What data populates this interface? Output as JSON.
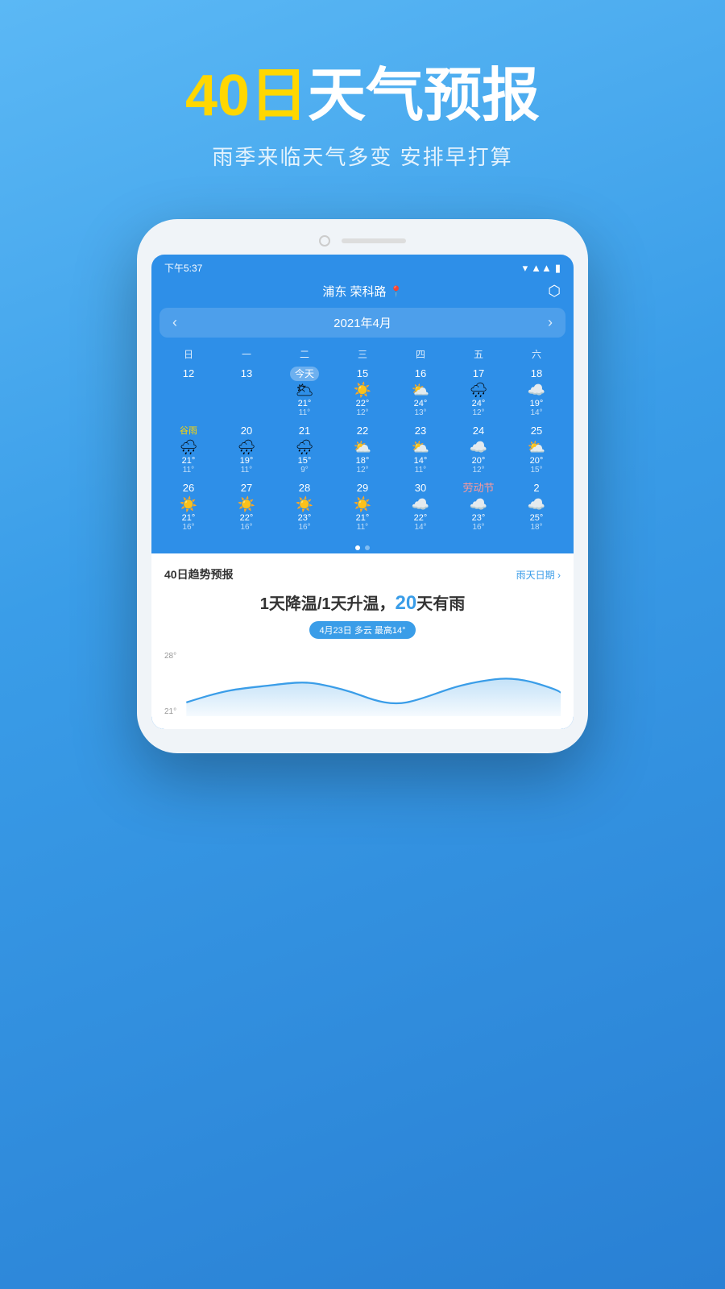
{
  "hero": {
    "title_yellow": "40日",
    "title_white": "天气预报",
    "subtitle": "雨季来临天气多变 安排早打算"
  },
  "phone": {
    "status": {
      "time": "下午5:37"
    },
    "location": "浦东 荣科路",
    "calendar_title": "2021年4月",
    "day_headers": [
      "日",
      "一",
      "二",
      "三",
      "四",
      "五",
      "六"
    ],
    "rows": [
      {
        "cells": [
          {
            "date": "12",
            "icon": "",
            "high": "",
            "low": "",
            "empty": true
          },
          {
            "date": "13",
            "icon": "",
            "high": "",
            "low": "",
            "empty": true
          },
          {
            "date": "今天",
            "icon": "🌥",
            "high": "21°",
            "low": "11°",
            "today": true
          },
          {
            "date": "15",
            "icon": "☀️",
            "high": "22°",
            "low": "12°"
          },
          {
            "date": "16",
            "icon": "⛅",
            "high": "24°",
            "low": "13°"
          },
          {
            "date": "17",
            "icon": "🌧",
            "high": "24°",
            "low": "12°"
          },
          {
            "date": "18",
            "icon": "☁️",
            "high": "19°",
            "low": "14°"
          }
        ]
      },
      {
        "cells": [
          {
            "date": "谷雨",
            "icon": "🌧",
            "high": "21°",
            "low": "11°",
            "special": true
          },
          {
            "date": "20",
            "icon": "🌧",
            "high": "19°",
            "low": "11°"
          },
          {
            "date": "21",
            "icon": "🌧",
            "high": "15°",
            "low": "9°"
          },
          {
            "date": "22",
            "icon": "⛅",
            "high": "18°",
            "low": "12°"
          },
          {
            "date": "23",
            "icon": "⛅",
            "high": "14°",
            "low": "11°"
          },
          {
            "date": "24",
            "icon": "☁️",
            "high": "20°",
            "low": "12°"
          },
          {
            "date": "25",
            "icon": "⛅",
            "high": "20°",
            "low": "15°"
          }
        ]
      },
      {
        "cells": [
          {
            "date": "26",
            "icon": "☀️",
            "high": "21°",
            "low": "16°"
          },
          {
            "date": "27",
            "icon": "☀️",
            "high": "22°",
            "low": "16°"
          },
          {
            "date": "28",
            "icon": "☀️",
            "high": "23°",
            "low": "16°"
          },
          {
            "date": "29",
            "icon": "☀️",
            "high": "21°",
            "low": "11°"
          },
          {
            "date": "30",
            "icon": "☁️",
            "high": "22°",
            "low": "14°"
          },
          {
            "date": "劳动节",
            "icon": "☁️",
            "high": "23°",
            "low": "16°",
            "holiday": true
          },
          {
            "date": "2",
            "icon": "☁️",
            "high": "25°",
            "low": "18°"
          }
        ]
      }
    ],
    "trend": {
      "title": "40日趋势预报",
      "rainy_label": "雨天日期",
      "summary": "1天降温/1天升温，20天有雨",
      "date_badge": "4月23日 多云 最高14°",
      "temp_labels": [
        "28°",
        "21°"
      ],
      "chart_line": "M0,55 C20,50 40,45 60,42 C80,39 100,38 120,36 C140,34 160,32 180,35 C200,38 220,42 240,48 C260,54 280,58 300,55 C320,52 340,45 360,40 C380,35 400,32 420,30 C440,28 460,30 480,35 C500,40 520,45 540,50"
    }
  }
}
